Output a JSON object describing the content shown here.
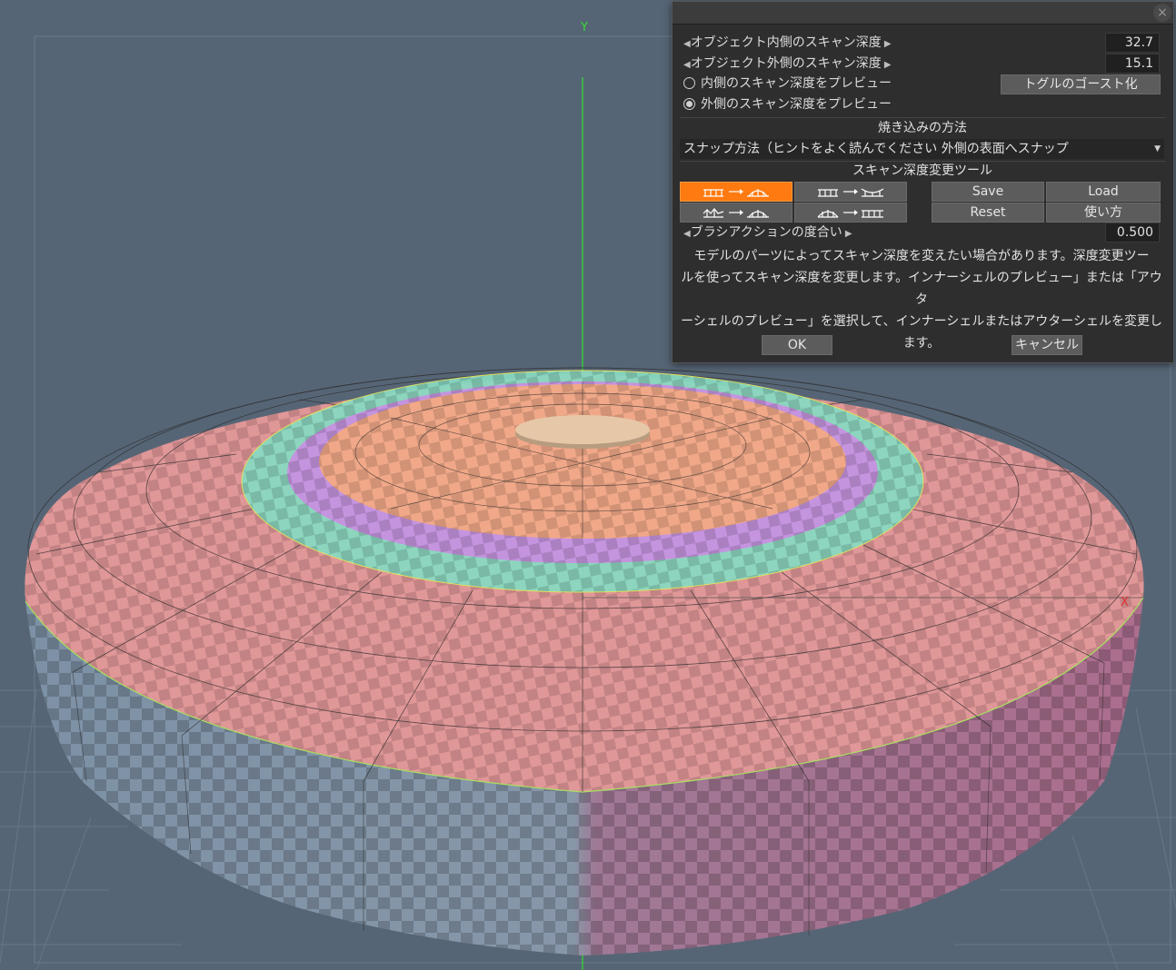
{
  "viewport": {
    "axis_y_label": "Y",
    "axis_x_label": "X",
    "colors": {
      "background": "#566575",
      "outer_cage": "#e89a9a",
      "inner_green_ring": "#88d8c0",
      "inner_purple_ring": "#c890e0",
      "inner_surface": "#f0a888",
      "center_disc": "#e6c8a8",
      "y_axis": "#33dd33",
      "x_axis": "#e03030"
    }
  },
  "dialog": {
    "close_label": "×",
    "inner_depth_label": "オブジェクト内側のスキャン深度",
    "inner_depth_value": "32.7",
    "outer_depth_label": "オブジェクト外側のスキャン深度",
    "outer_depth_value": "15.1",
    "preview_inner_label": "内側のスキャン深度をプレビュー",
    "preview_outer_label": "外側のスキャン深度をプレビュー",
    "ghost_toggle_label": "トグルのゴースト化",
    "bake_section_title": "焼き込みの方法",
    "snap_method_value": "スナップ方法（ヒントをよく読んでください 外側の表面へスナップ",
    "tool_section_title": "スキャン深度変更ツール",
    "save_label": "Save",
    "load_label": "Load",
    "reset_label": "Reset",
    "usage_label": "使い方",
    "brush_strength_label": "ブラシアクションの度合い",
    "brush_strength_value": "0.500",
    "help_line1": "モデルのパーツによってスキャン深度を変えたい場合があります。深度変更ツー",
    "help_line2": "ルを使ってスキャン深度を変更します。インナーシェルのプレビュー」または「アウタ",
    "help_line3": "ーシェルのプレビュー」を選択して、インナーシェルまたはアウターシェルを変更し",
    "help_line4": "ます。",
    "ok_label": "OK",
    "cancel_label": "キャンセル",
    "active_tool_color": "#ff7a10"
  }
}
